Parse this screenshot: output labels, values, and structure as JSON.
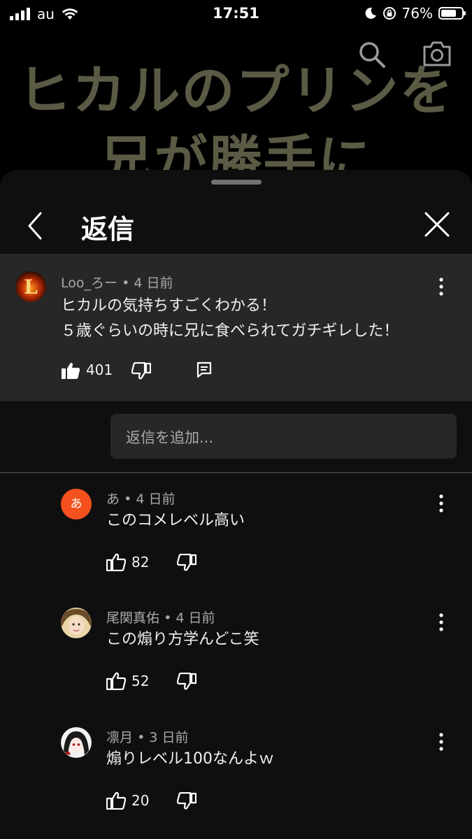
{
  "status_bar": {
    "carrier": "au",
    "time": "17:51",
    "battery": "76%",
    "battery_level": 0.76
  },
  "video": {
    "title_line1": "ヒカルのプリンを",
    "title_line2": "兄が勝手に"
  },
  "sheet": {
    "title": "返信"
  },
  "parent_comment": {
    "author": "Loo_ろー",
    "time": "4 日前",
    "line1": "ヒカルの気持ちすごくわかる！",
    "line2": "５歳ぐらいの時に兄に食べられてガチギレした！",
    "likes": "401",
    "avatar_letter": "L"
  },
  "reply_input": {
    "placeholder": "返信を追加..."
  },
  "replies": [
    {
      "author": "あ",
      "time": "4 日前",
      "text": "このコメレベル高い",
      "likes": "82",
      "avatar_letter": "あ",
      "avatar_color": "#f4511e"
    },
    {
      "author": "尾関真佑",
      "time": "4 日前",
      "text": "この煽り方学んどこ笑",
      "likes": "52"
    },
    {
      "author": "凛月",
      "time": "3 日前",
      "text": "煽りレベル100なんよｗ",
      "likes": "20"
    }
  ],
  "separator": "•"
}
